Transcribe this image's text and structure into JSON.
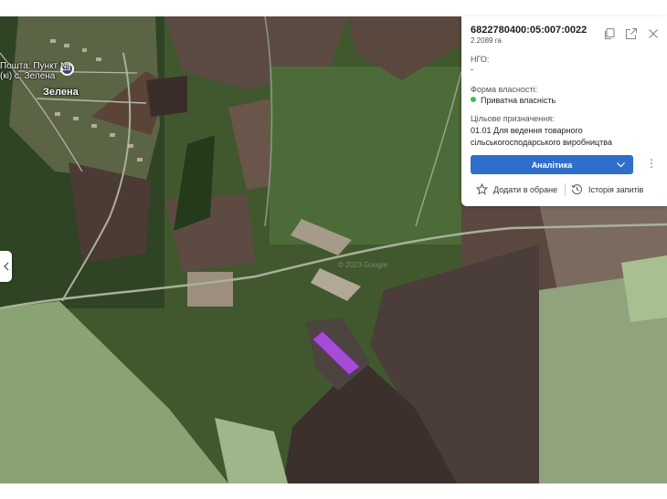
{
  "map": {
    "poi_label_line1": "Пошта: Пункт №",
    "poi_label_line2": "(кі) с. Зелена",
    "village_label": "Зелена",
    "watermark": "© 2023 Google",
    "parcel_color": "#a64dd6"
  },
  "panel": {
    "cadastral_number": "6822780400:05:007:0022",
    "area": "2.2089 га",
    "ngo_label": "НГО:",
    "ngo_value": "-",
    "ownership_label": "Форма власності:",
    "ownership_value": "Приватна власність",
    "purpose_label": "Цільове призначення:",
    "purpose_line1": "01.01 Для ведення товарного",
    "purpose_line2": "сільськогосподарського виробництва",
    "analytics_label": "Аналітика",
    "add_favorite_label": "Додати в обране",
    "history_label": "Історія запитів",
    "icons": [
      "copy-icon",
      "share-icon",
      "close-icon",
      "chevron-down-icon",
      "more-icon",
      "star-icon",
      "history-icon"
    ]
  },
  "colors": {
    "accent": "#2f6ecb",
    "status_green": "#3fbf4f"
  }
}
